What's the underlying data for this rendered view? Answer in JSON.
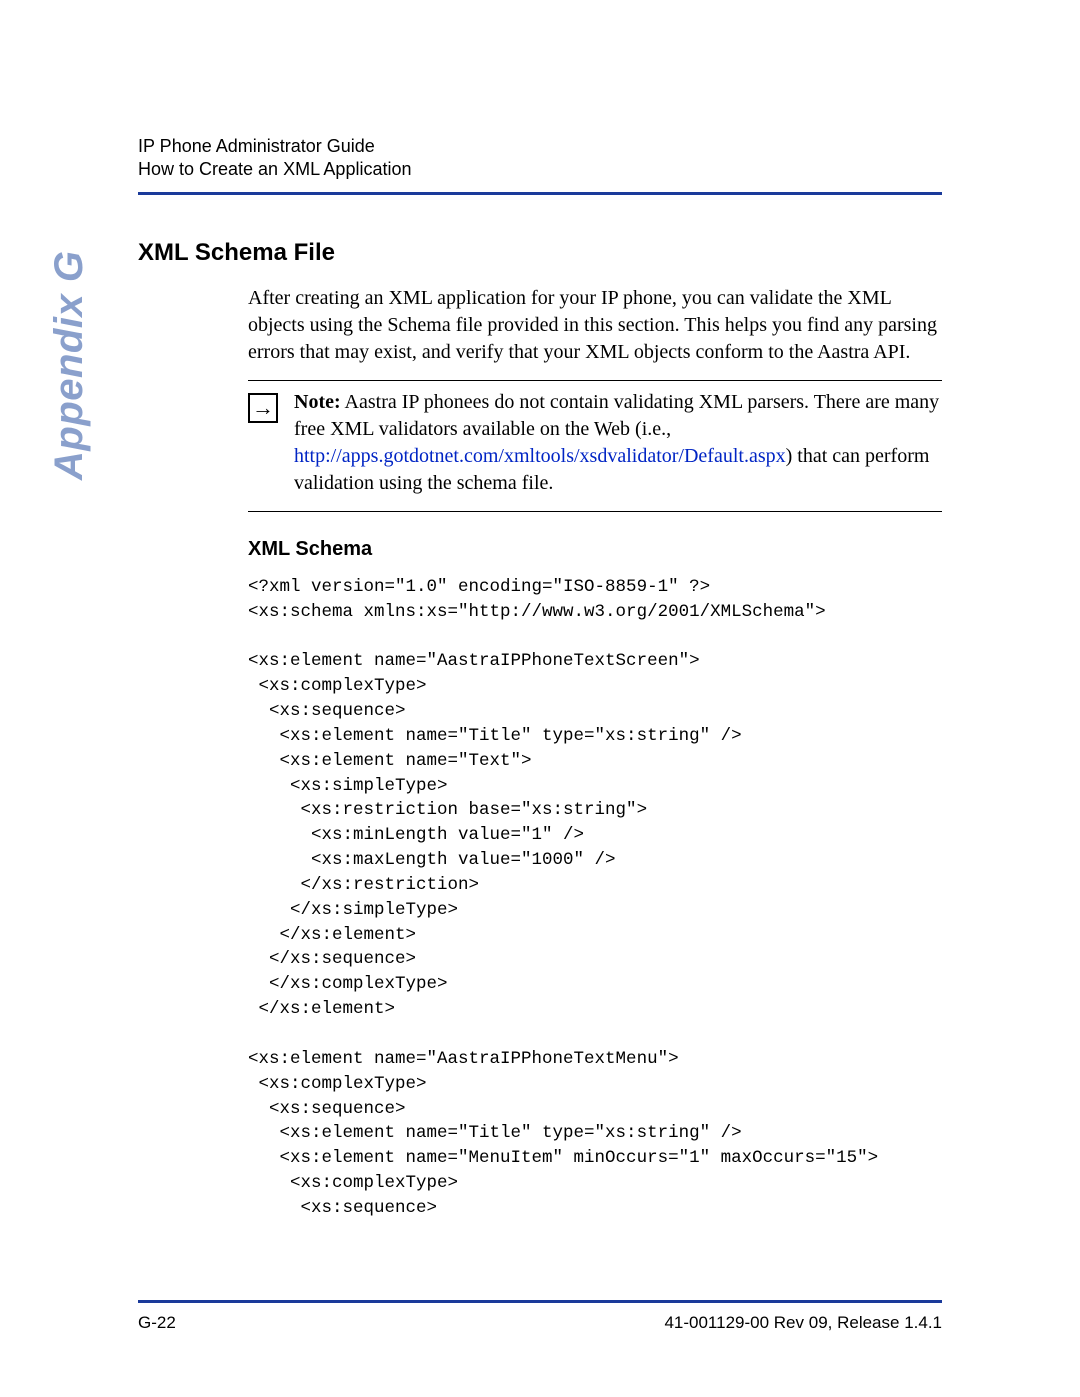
{
  "header": {
    "line1": "IP Phone Administrator Guide",
    "line2": "How to Create an XML Application"
  },
  "side_tab": "Appendix G",
  "section": {
    "title": "XML Schema File",
    "intro": "After creating an XML application for your IP phone, you can validate the XML objects using the Schema file provided in this section. This helps you find any parsing errors that may exist, and verify that your XML objects conform to the Aastra API.",
    "note": {
      "icon": "→",
      "label": "Note:",
      "text_before_link": " Aastra IP phonees do not contain validating XML parsers. There are many free XML validators available on the Web (i.e., ",
      "link_text": "http://apps.gotdotnet.com/xmltools/xsdvalidator/Default.aspx",
      "text_after_link": ") that can perform validation using the schema file."
    },
    "subheading": "XML Schema",
    "code": "<?xml version=\"1.0\" encoding=\"ISO-8859-1\" ?>\n<xs:schema xmlns:xs=\"http://www.w3.org/2001/XMLSchema\">\n\n<xs:element name=\"AastraIPPhoneTextScreen\">\n <xs:complexType>\n  <xs:sequence>\n   <xs:element name=\"Title\" type=\"xs:string\" />\n   <xs:element name=\"Text\">\n    <xs:simpleType>\n     <xs:restriction base=\"xs:string\">\n      <xs:minLength value=\"1\" />\n      <xs:maxLength value=\"1000\" />\n     </xs:restriction>\n    </xs:simpleType>\n   </xs:element>\n  </xs:sequence>\n  </xs:complexType>\n </xs:element>\n\n<xs:element name=\"AastraIPPhoneTextMenu\">\n <xs:complexType>\n  <xs:sequence>\n   <xs:element name=\"Title\" type=\"xs:string\" />\n   <xs:element name=\"MenuItem\" minOccurs=\"1\" maxOccurs=\"15\">\n    <xs:complexType>\n     <xs:sequence>"
  },
  "footer": {
    "left": "G-22",
    "right": "41-001129-00 Rev 09, Release 1.4.1"
  }
}
